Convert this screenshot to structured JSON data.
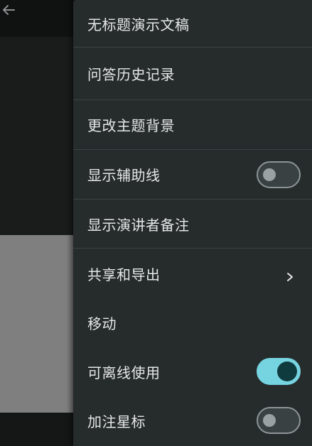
{
  "menu": {
    "title": "无标题演示文稿",
    "items": [
      {
        "label": "问答历史记录"
      },
      {
        "label": "更改主题背景"
      },
      {
        "label": "显示辅助线",
        "toggle": false
      },
      {
        "label": "显示演讲者备注"
      },
      {
        "label": "共享和导出",
        "icon": "chevron-right-icon"
      },
      {
        "label": "移动"
      },
      {
        "label": "可离线使用",
        "toggle": true
      },
      {
        "label": "加注星标",
        "toggle": false
      }
    ]
  },
  "colors": {
    "menu_bg": "#262b2c",
    "text": "#e6e8e8",
    "toggle_on": "#76d3e0",
    "toggle_on_knob": "#0f3b3f",
    "toggle_off_track": "#3a4142"
  },
  "icons": {
    "back": "arrow-left-icon"
  }
}
